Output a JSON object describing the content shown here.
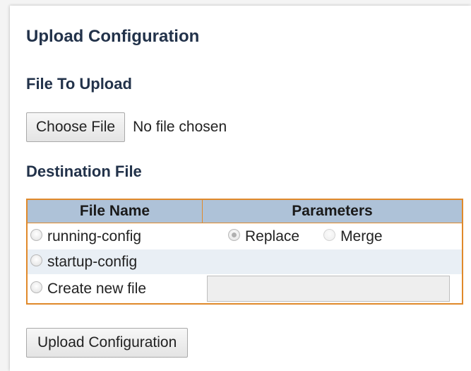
{
  "page": {
    "title": "Upload Configuration"
  },
  "upload": {
    "section_title": "File To Upload",
    "choose_button": "Choose File",
    "file_status": "No file chosen"
  },
  "destination": {
    "section_title": "Destination File",
    "headers": {
      "file_name": "File Name",
      "parameters": "Parameters"
    },
    "rows": [
      {
        "label": "running-config",
        "selected": false
      },
      {
        "label": "startup-config",
        "selected": false
      },
      {
        "label": "Create new file",
        "selected": false
      }
    ],
    "parameters": {
      "replace_label": "Replace",
      "replace_selected": true,
      "merge_label": "Merge",
      "merge_selected": false,
      "enabled": false
    },
    "new_file_value": ""
  },
  "actions": {
    "upload_button": "Upload Configuration"
  },
  "colors": {
    "table_border": "#e0892a",
    "header_bg": "#aec2d8",
    "alt_row_bg": "#e9eff5",
    "title_color": "#22324a"
  }
}
